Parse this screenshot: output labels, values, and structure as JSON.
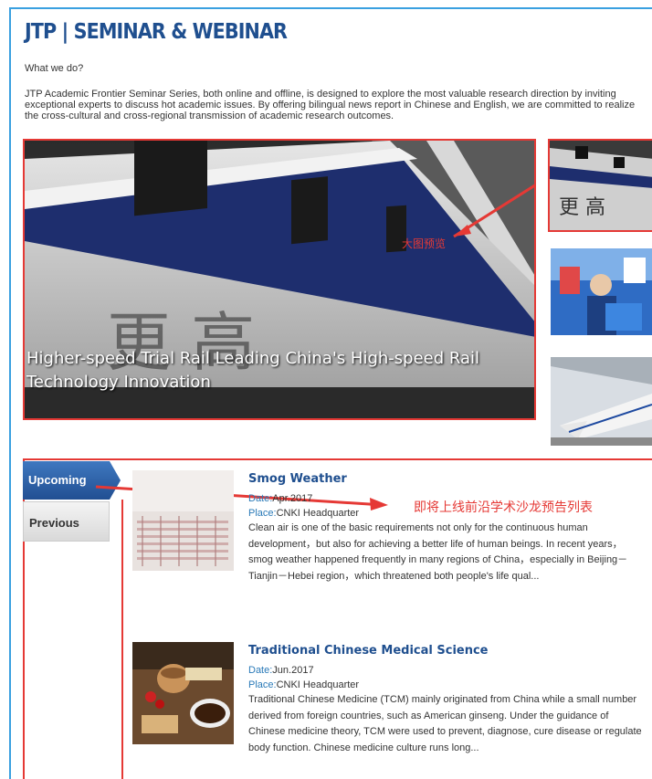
{
  "header": {
    "title": "JTP | SEMINAR & WEBINAR",
    "what_we_do": "What we do?",
    "intro": "JTP Academic Frontier Seminar Series, both online and offline, is designed to explore the most valuable research direction by inviting exceptional experts to discuss hot academic issues. By offering bilingual news report in Chinese and English, we are committed to realize the cross-cultural and cross-regional transmission of academic research outcomes."
  },
  "hero": {
    "caption": "Higher-speed Trial Rail Leading China's High-speed Rail Technology Innovation",
    "annotation": "大图预览"
  },
  "tabs": {
    "upcoming": "Upcoming",
    "previous": "Previous",
    "annotation": "即将上线前沿学术沙龙预告列表"
  },
  "items": [
    {
      "title": "Smog Weather",
      "date_label": "Date:",
      "date": "Apr.2017",
      "place_label": "Place:",
      "place": "CNKI Headquarter",
      "description": "Clean air is one of the basic requirements not only for the continuous human development，but also for achieving a better life of human beings. In recent years，smog weather happened frequently in many regions of China，especially in Beijing－Tianjin－Hebei region，which threatened both people's life qual..."
    },
    {
      "title": "Traditional Chinese Medical Science",
      "date_label": "Date:",
      "date": "Jun.2017",
      "place_label": "Place:",
      "place": "CNKI Headquarter",
      "description": "Traditional Chinese Medicine (TCM) mainly originated from China while a small number derived from foreign countries, such as American ginseng. Under the guidance of Chinese medicine theory, TCM were used to prevent, diagnose, cure disease or regulate body function. Chinese medicine culture runs long..."
    }
  ],
  "colors": {
    "title_blue": "#1f4f8f",
    "annotation_red": "#e53935",
    "tab_active": "#2a5fa0",
    "frame_blue": "#3aa0e0"
  }
}
